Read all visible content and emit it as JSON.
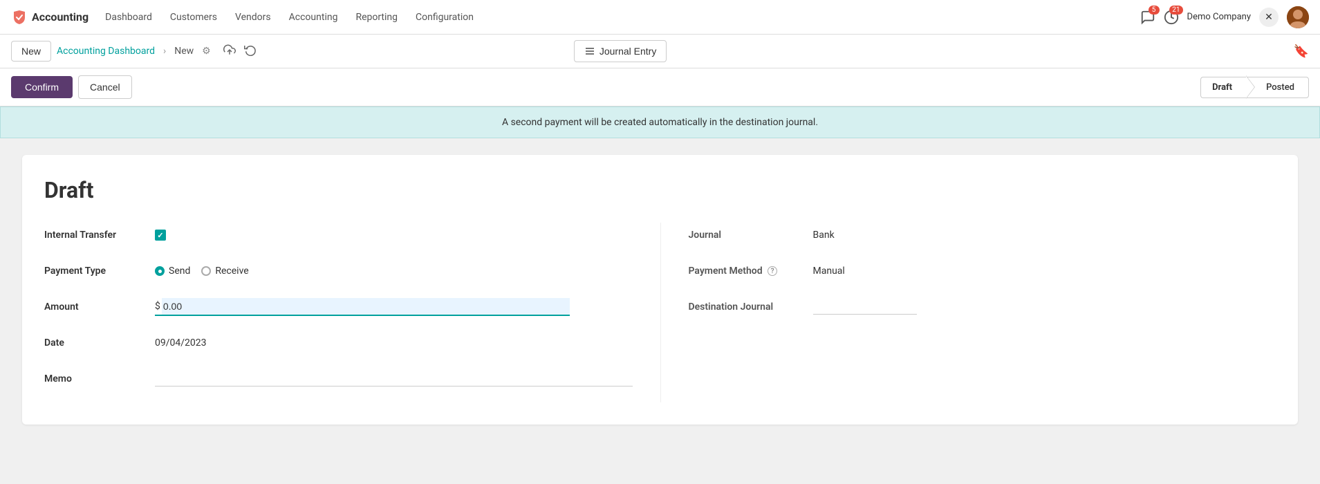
{
  "app": {
    "logo_text": "Accounting",
    "logo_color": "#e74c3c"
  },
  "nav": {
    "items": [
      {
        "label": "Dashboard",
        "id": "dashboard"
      },
      {
        "label": "Customers",
        "id": "customers"
      },
      {
        "label": "Vendors",
        "id": "vendors"
      },
      {
        "label": "Accounting",
        "id": "accounting"
      },
      {
        "label": "Reporting",
        "id": "reporting"
      },
      {
        "label": "Configuration",
        "id": "configuration"
      }
    ]
  },
  "topbar": {
    "messages_badge": "5",
    "activity_badge": "21",
    "company_name": "Demo Company"
  },
  "toolbar": {
    "new_label": "New",
    "breadcrumb_home": "Accounting Dashboard",
    "breadcrumb_current": "New",
    "journal_entry_label": "Journal Entry"
  },
  "action_bar": {
    "confirm_label": "Confirm",
    "cancel_label": "Cancel",
    "status_steps": [
      {
        "label": "Draft",
        "active": true
      },
      {
        "label": "Posted",
        "active": false
      }
    ]
  },
  "banner": {
    "message": "A second payment will be created automatically in the destination journal."
  },
  "form": {
    "title": "Draft",
    "left": {
      "internal_transfer_label": "Internal Transfer",
      "payment_type_label": "Payment Type",
      "payment_type_send": "Send",
      "payment_type_receive": "Receive",
      "amount_label": "Amount",
      "amount_prefix": "$",
      "amount_value": "0.00",
      "date_label": "Date",
      "date_value": "09/04/2023",
      "memo_label": "Memo"
    },
    "right": {
      "journal_label": "Journal",
      "journal_value": "Bank",
      "payment_method_label": "Payment Method",
      "payment_method_value": "Manual",
      "destination_journal_label": "Destination Journal",
      "destination_journal_value": ""
    }
  }
}
